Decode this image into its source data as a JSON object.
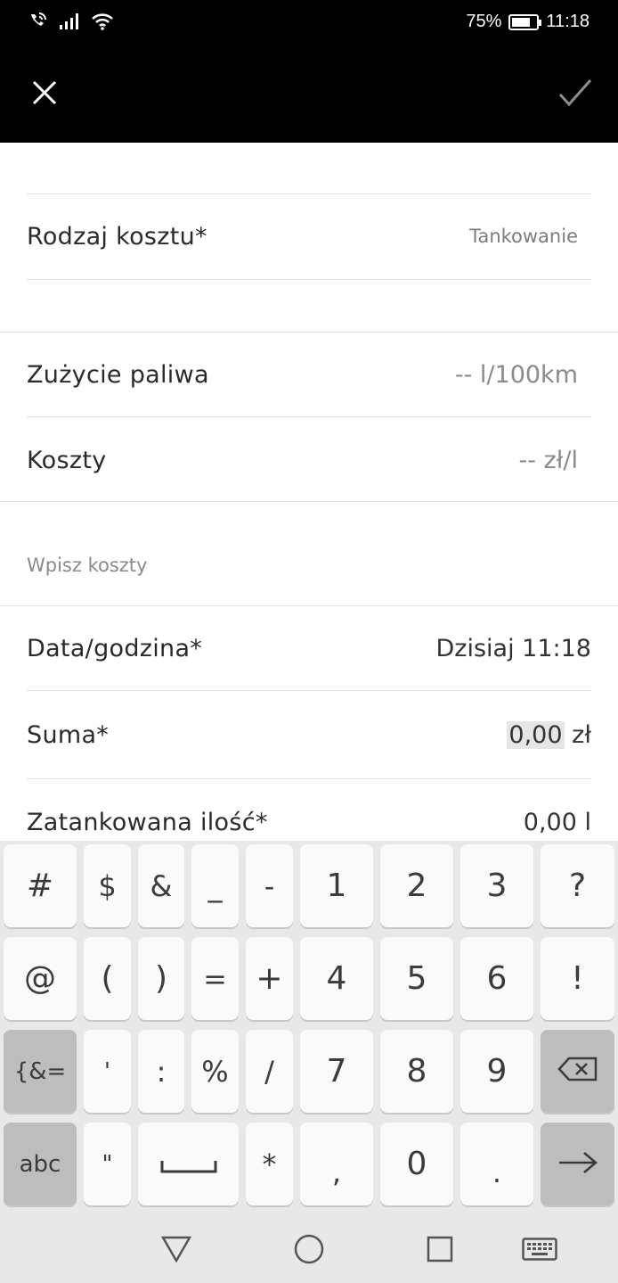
{
  "status_bar": {
    "battery": "75%",
    "battery_level": 0.75,
    "time": "11:18"
  },
  "app_bar": {
    "close_icon": "close-icon",
    "confirm_icon": "check-icon"
  },
  "form": {
    "cost_type": {
      "label": "Rodzaj kosztu*",
      "value": "Tankowanie"
    },
    "fuel_consumption": {
      "label": "Zużycie paliwa",
      "value": "-- l/100km"
    },
    "costs": {
      "label": "Koszty",
      "value": "-- zł/l"
    },
    "enter_costs_hint": "Wpisz koszty",
    "datetime": {
      "label": "Data/godzina*",
      "value": "Dzisiaj 11:18"
    },
    "sum": {
      "label": "Suma*",
      "value": "0,00",
      "unit": "zł"
    },
    "amount": {
      "label": "Zatankowana ilość*",
      "value": "0,00",
      "unit": "l"
    }
  },
  "keyboard": {
    "row1": [
      "#",
      "$",
      "&",
      "_",
      "-",
      "1",
      "2",
      "3",
      "?"
    ],
    "row2": [
      "@",
      "(",
      ")",
      "=",
      "+",
      "4",
      "5",
      "6",
      "!"
    ],
    "row3": [
      "{&=",
      "'",
      ":",
      "%",
      "/",
      "7",
      "8",
      "9"
    ],
    "row4": [
      "abc",
      "\"",
      "*",
      ",",
      "0",
      "."
    ],
    "icons": {
      "backspace": "backspace-icon",
      "space": "space-icon",
      "enter": "arrow-right-icon"
    }
  },
  "nav_bar": {
    "icons": [
      "back-triangle-icon",
      "home-circle-icon",
      "recents-square-icon",
      "keyboard-icon"
    ]
  }
}
